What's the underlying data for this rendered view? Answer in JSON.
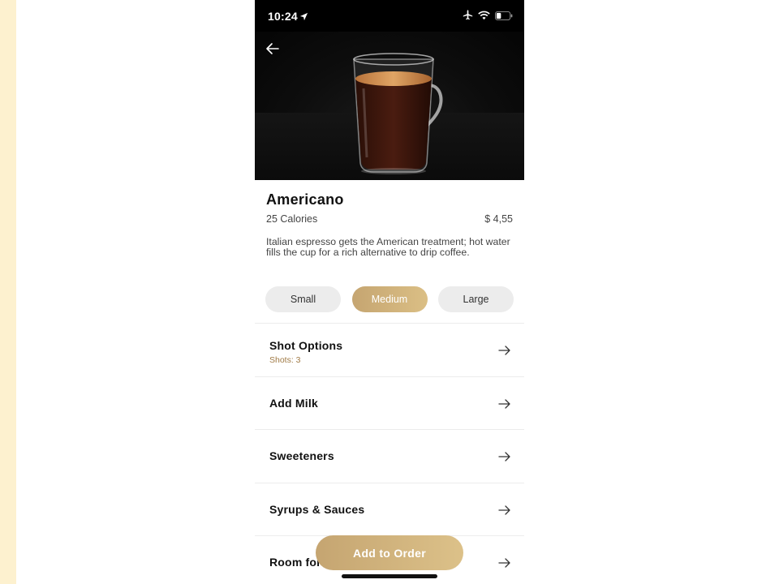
{
  "status_bar": {
    "time": "10:24",
    "icons": [
      "location-arrow-icon",
      "airplane-icon",
      "wifi-icon",
      "battery-icon"
    ]
  },
  "product": {
    "name": "Americano",
    "calories": "25 Calories",
    "price": "$ 4,55",
    "description": "Italian espresso gets the American treatment; hot water fills the cup for a rich alternative to drip coffee."
  },
  "sizes": [
    {
      "label": "Small",
      "selected": false
    },
    {
      "label": "Medium",
      "selected": true
    },
    {
      "label": "Large",
      "selected": false
    }
  ],
  "options": [
    {
      "label": "Shot Options",
      "sub": "Shots: 3"
    },
    {
      "label": "Add Milk"
    },
    {
      "label": "Sweeteners"
    },
    {
      "label": "Syrups & Sauces"
    },
    {
      "label": "Room for Cream"
    }
  ],
  "cta": {
    "label": "Add to Order"
  },
  "colors": {
    "accent_gold": "#c5a571",
    "sub_text_brown": "#a07a45",
    "page_left_strip": "#fdf1cf"
  }
}
